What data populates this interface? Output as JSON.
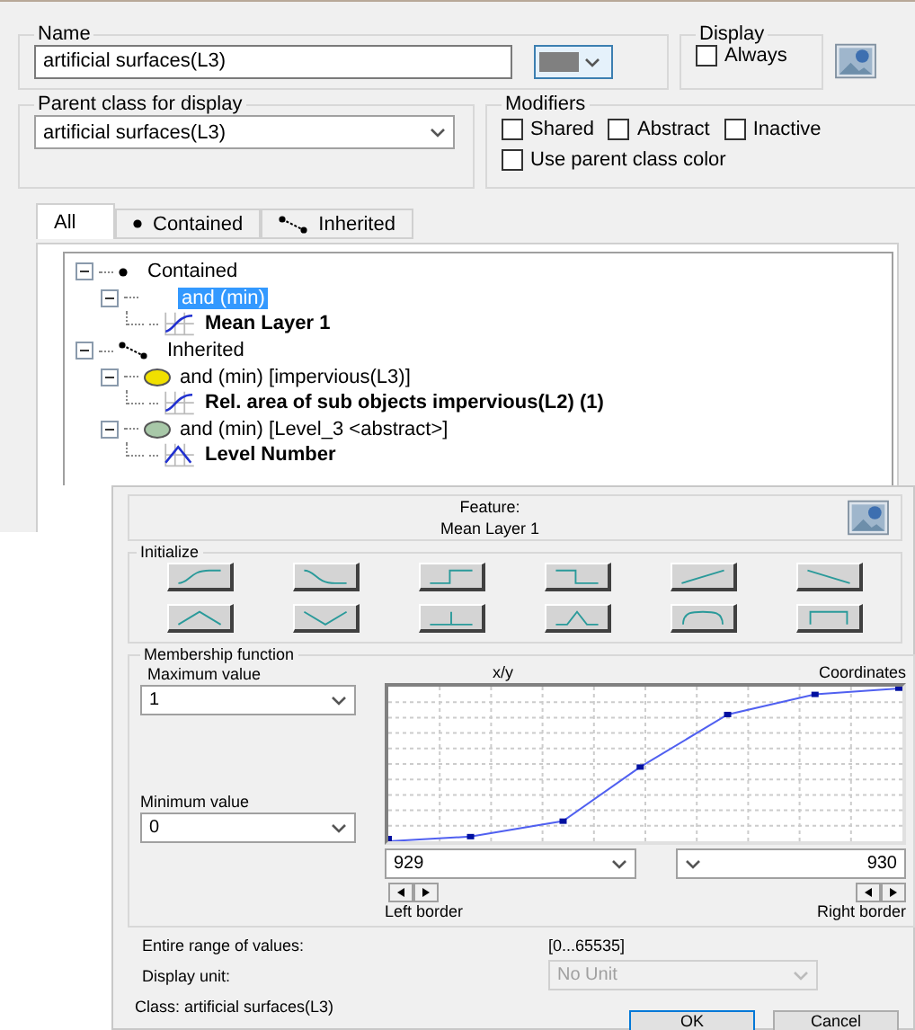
{
  "class_dialog": {
    "name": {
      "label": "Name",
      "value": "artificial surfaces(L3)"
    },
    "display": {
      "label": "Display",
      "options": [
        {
          "label": "Always",
          "checked": false
        }
      ]
    },
    "parent_class": {
      "label": "Parent class for display",
      "value": "artificial surfaces(L3)"
    },
    "modifiers": {
      "label": "Modifiers",
      "options": [
        {
          "label": "Shared",
          "checked": false
        },
        {
          "label": "Abstract",
          "checked": false
        },
        {
          "label": "Inactive",
          "checked": false
        },
        {
          "label": "Use parent class color",
          "checked": false
        }
      ]
    },
    "tabs": [
      {
        "label": "All",
        "selected": true,
        "kind": "none"
      },
      {
        "label": "Contained",
        "selected": false,
        "kind": "dot"
      },
      {
        "label": "Inherited",
        "selected": false,
        "kind": "link"
      }
    ],
    "tree": [
      {
        "label": "Contained",
        "kind": "dot",
        "selected": false,
        "expanded": true,
        "children": [
          {
            "label": "and (min)",
            "kind": "operator",
            "selected": true,
            "expanded": true,
            "children": [
              {
                "label": "Mean Layer 1",
                "kind": "rising",
                "selected": false
              }
            ]
          }
        ]
      },
      {
        "label": "Inherited",
        "kind": "link",
        "selected": false,
        "expanded": true,
        "children": [
          {
            "label": "and (min) [impervious(L3)]",
            "kind": "operator",
            "color": "#f0e000",
            "selected": false,
            "expanded": true,
            "children": [
              {
                "label": "Rel. area of sub objects impervious(L2) (1)",
                "kind": "rising",
                "selected": false
              }
            ]
          },
          {
            "label": "and (min) [Level_3 <abstract>]",
            "kind": "operator",
            "color": "#a8c8a8",
            "selected": false,
            "expanded": true,
            "children": [
              {
                "label": "Level Number",
                "kind": "peak",
                "selected": false
              }
            ]
          }
        ]
      }
    ]
  },
  "feature_dialog": {
    "title": "Feature:",
    "feature": "Mean Layer 1",
    "initialize": {
      "label": "Initialize"
    },
    "membership": {
      "label": "Membership function",
      "max_label": "Maximum value",
      "max_value": "1",
      "min_label": "Minimum value",
      "min_value": "0",
      "plot_label": "x/y",
      "coords_label": "Coordinates",
      "left_value": "929",
      "right_value": "930",
      "left_border": "Left border",
      "right_border": "Right border"
    },
    "range_label": "Entire range of values:",
    "range_value": "[0...65535]",
    "unit_label": "Display unit:",
    "unit_value": "No Unit",
    "unit_disabled": true,
    "class_label": "Class:  artificial surfaces(L3)",
    "buttons": [
      "OK",
      "Cancel"
    ]
  }
}
